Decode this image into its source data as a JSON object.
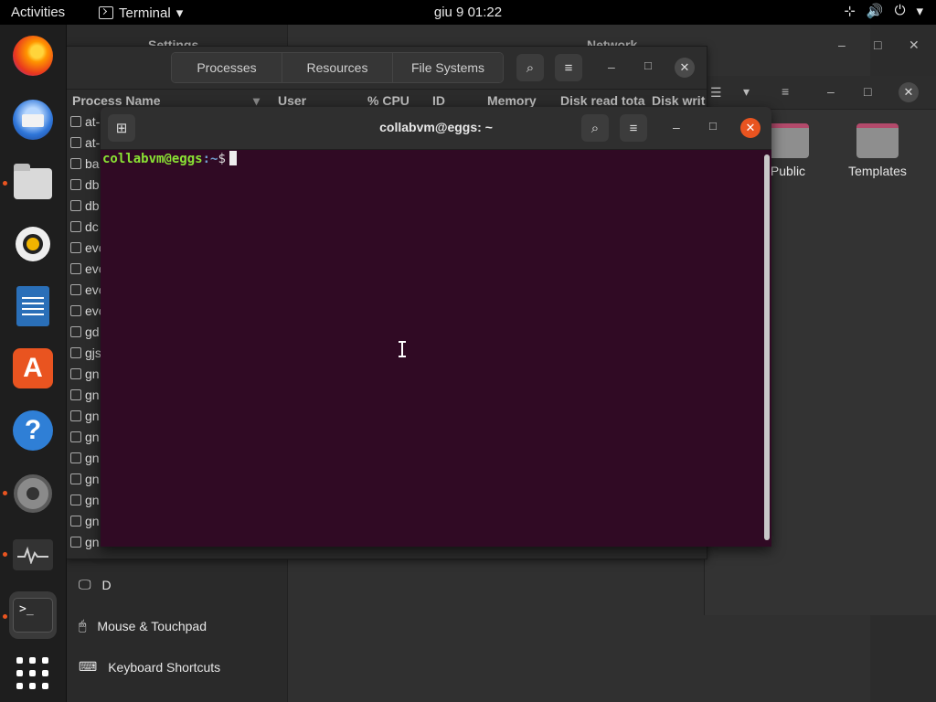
{
  "topbar": {
    "activities": "Activities",
    "app_name": "Terminal",
    "clock": "giu 9  01:22"
  },
  "dock": {
    "items": [
      {
        "name": "firefox",
        "icon": "firefox-icon"
      },
      {
        "name": "thunderbird",
        "icon": "thunderbird-icon"
      },
      {
        "name": "files",
        "icon": "files-icon"
      },
      {
        "name": "rhythmbox",
        "icon": "rhythmbox-icon"
      },
      {
        "name": "libreoffice-writer",
        "icon": "writer-icon"
      },
      {
        "name": "ubuntu-software",
        "icon": "software-store-icon"
      },
      {
        "name": "help",
        "icon": "help-icon"
      },
      {
        "name": "settings",
        "icon": "settings-icon"
      },
      {
        "name": "system-monitor",
        "icon": "system-monitor-icon"
      },
      {
        "name": "terminal",
        "icon": "terminal-icon"
      },
      {
        "name": "show-applications",
        "icon": "app-grid-icon"
      }
    ],
    "terminal_glyph": ">_"
  },
  "settings": {
    "title": "Settings",
    "section_title": "Network",
    "items": [
      "D",
      "Mouse & Touchpad",
      "Keyboard Shortcuts"
    ]
  },
  "files": {
    "folders": [
      "Public",
      "Templates"
    ]
  },
  "sysmon": {
    "tabs": [
      "Processes",
      "Resources",
      "File Systems"
    ],
    "columns": [
      "Process Name",
      "User",
      "% CPU",
      "ID",
      "Memory",
      "Disk read tota",
      "Disk writ"
    ],
    "processes": [
      "at-",
      "at-",
      "ba",
      "db",
      "db",
      "dc",
      "eve",
      "eve",
      "eve",
      "eve",
      "gd",
      "gjs",
      "gn",
      "gn",
      "gn",
      "gn",
      "gn",
      "gn",
      "gn",
      "gn",
      "gn"
    ]
  },
  "terminal": {
    "title": "collabvm@eggs: ~",
    "prompt_user": "collabvm@eggs",
    "prompt_path": ":~",
    "prompt_symbol": "$"
  },
  "colors": {
    "terminal_bg": "#300a24",
    "prompt_user": "#8ae234",
    "prompt_path": "#729fcf",
    "close_button": "#e95420"
  }
}
